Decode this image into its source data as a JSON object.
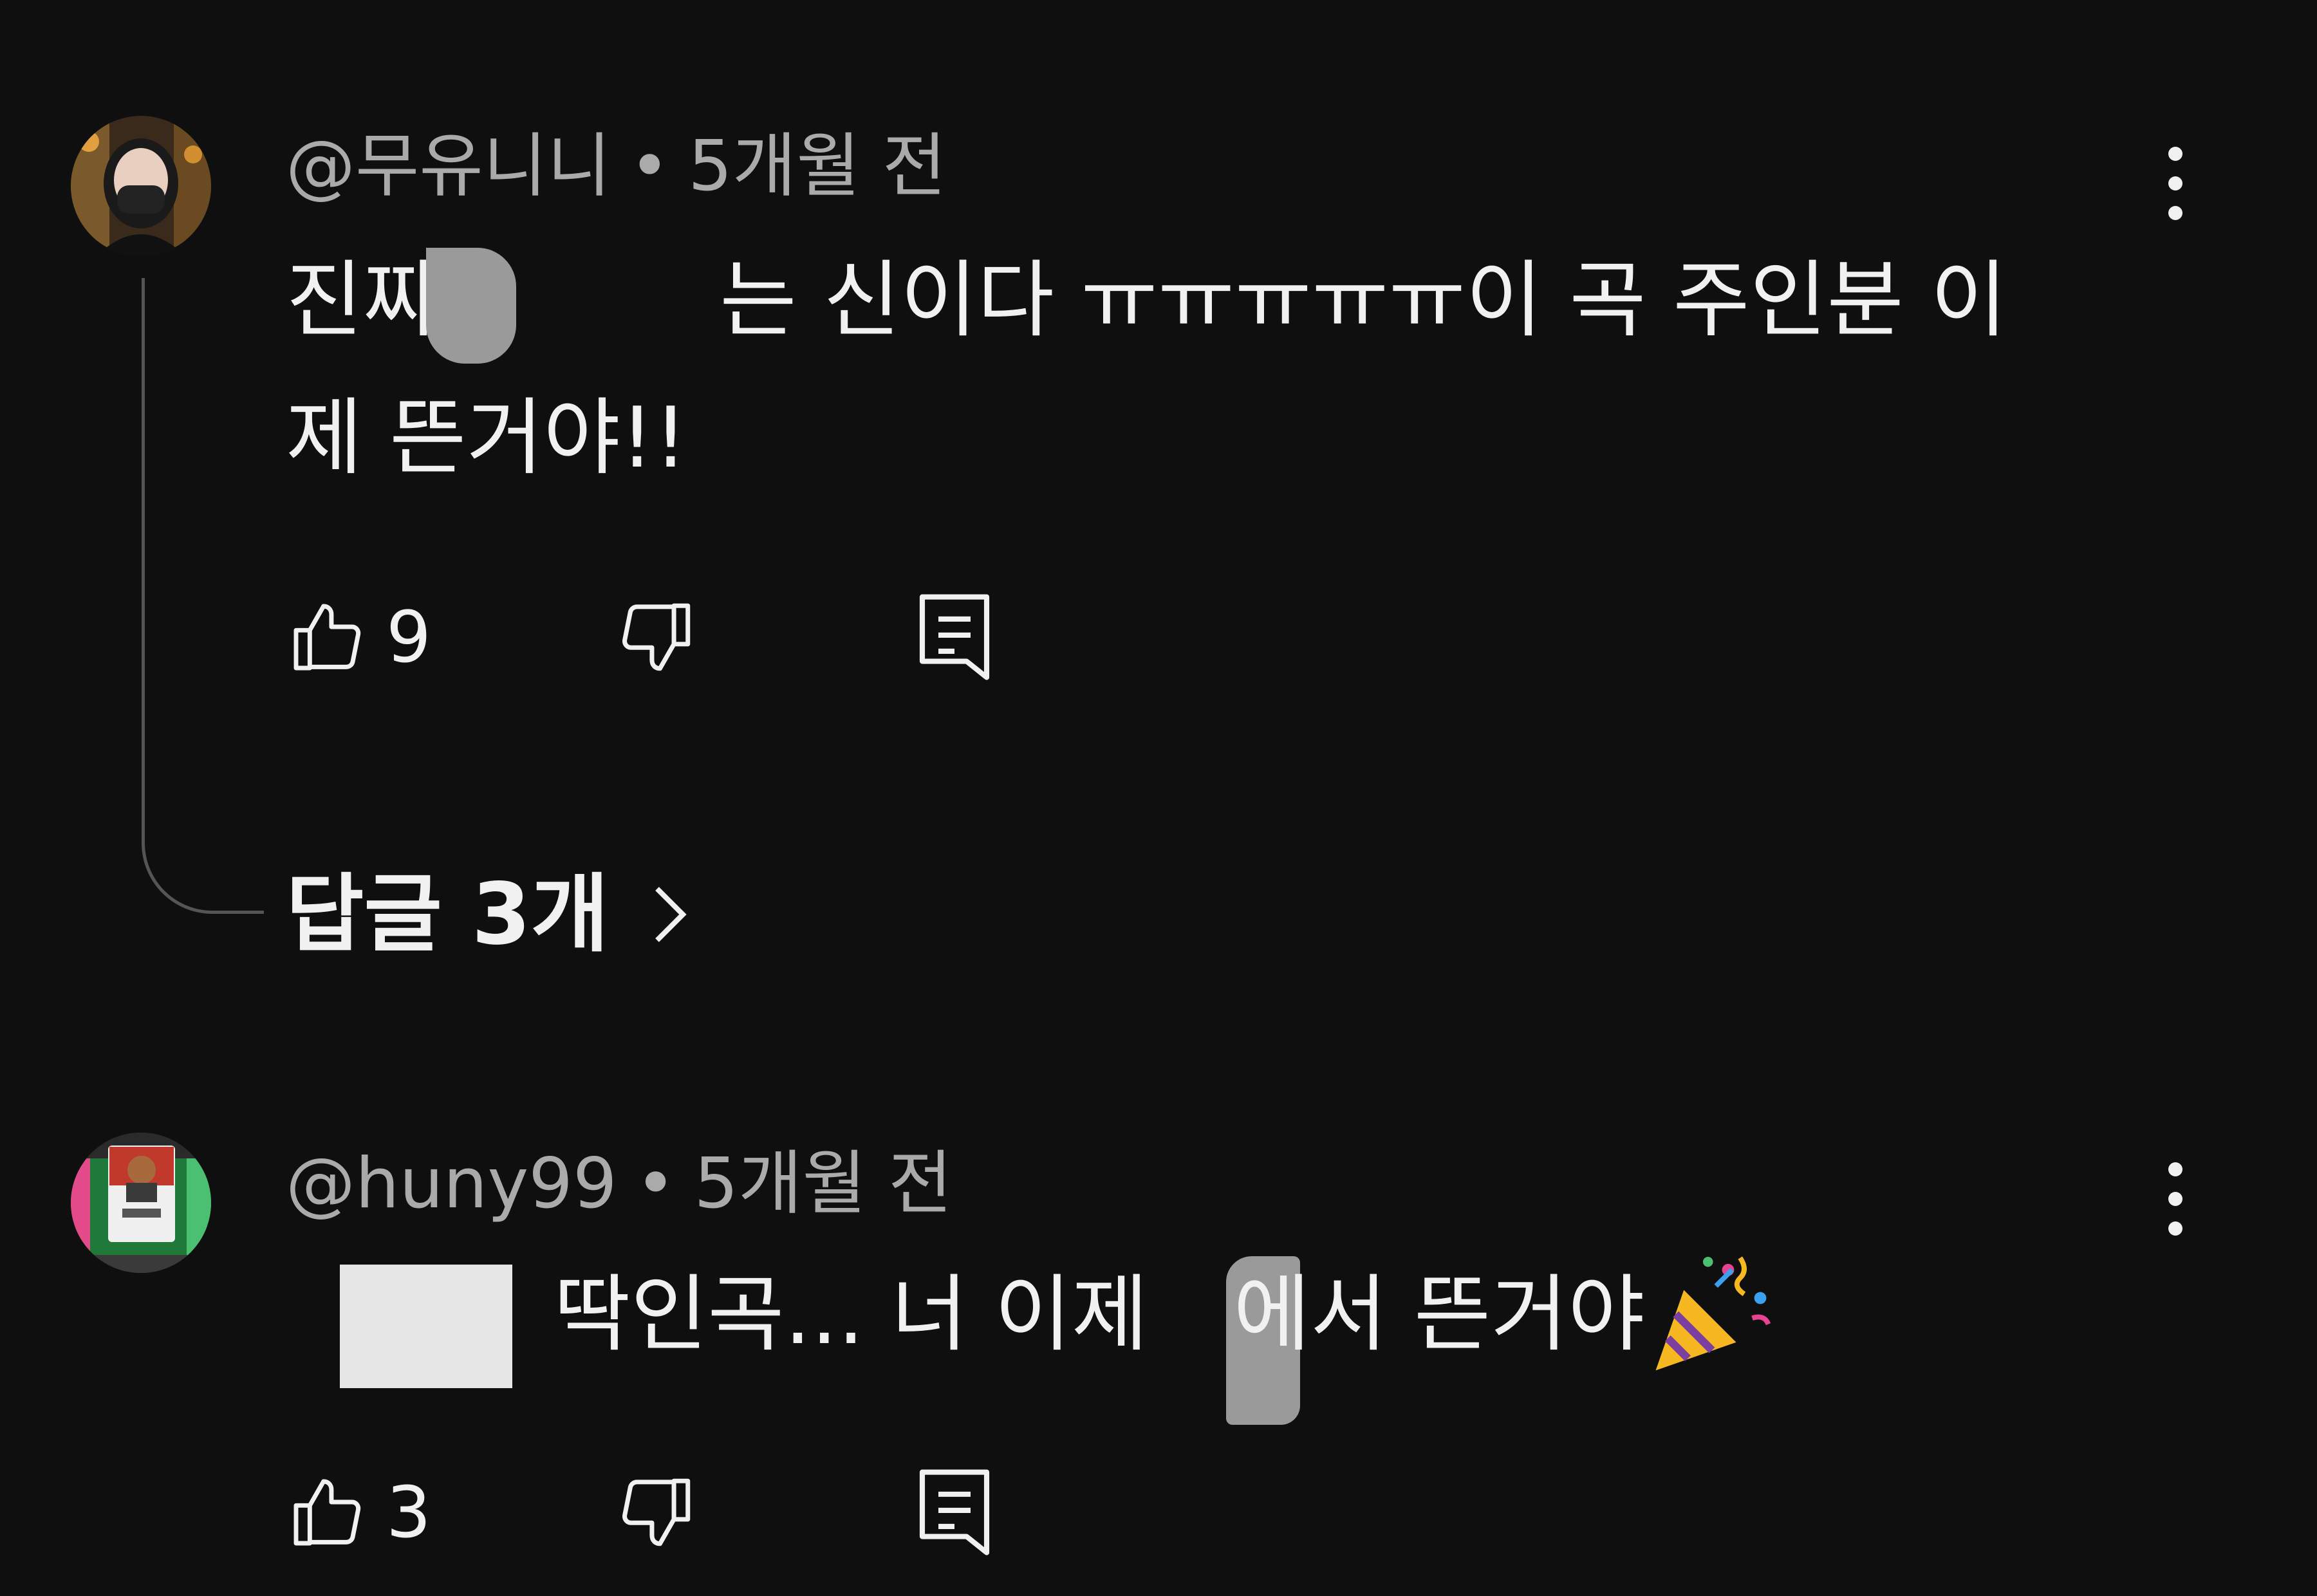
{
  "comments": [
    {
      "author": "@무유니니",
      "time": "5개월 전",
      "text_line1_a": "진짜",
      "text_line1_b": "는 신이다 ㅠㅠㅠㅠㅠ이 곡  주인분 이",
      "text_line2": "제 뜬거야!!",
      "likes": "9",
      "replies_label": "답글 3개"
    },
    {
      "author": "@huny99",
      "time": "5개월 전",
      "text_a": "딱인곡...  너 이제",
      "text_b": "에서 뜬거야",
      "likes": "3"
    }
  ],
  "separator": "•",
  "icons": {
    "like": "thumbs-up-icon",
    "dislike": "thumbs-down-icon",
    "reply": "reply-icon",
    "more": "more-vertical-icon",
    "replies_chevron": "chevron-right-icon",
    "emoji": "party-popper-icon"
  },
  "colors": {
    "background": "#0f0f0f",
    "text": "#f1f1f1",
    "meta": "#aaaaaa",
    "thread_line": "#555555"
  }
}
